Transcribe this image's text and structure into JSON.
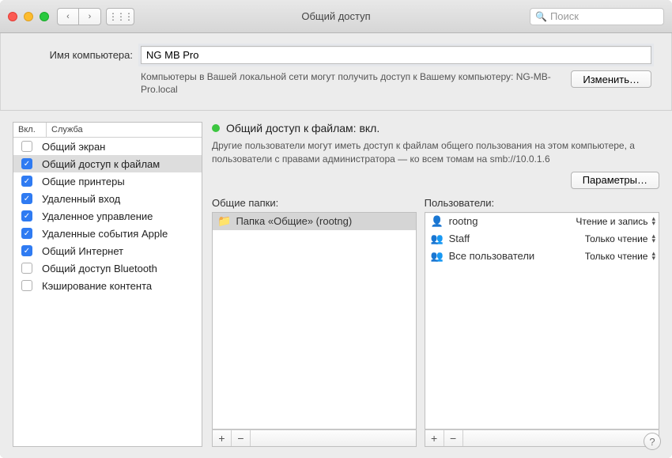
{
  "window": {
    "title": "Общий доступ"
  },
  "search": {
    "placeholder": "Поиск"
  },
  "computer": {
    "label": "Имя компьютера:",
    "value": "NG MB Pro",
    "description": "Компьютеры в Вашей локальной сети могут получить доступ к Вашему компьютеру: NG-MB-Pro.local",
    "edit_button": "Изменить…"
  },
  "services": {
    "header_on": "Вкл.",
    "header_name": "Служба",
    "items": [
      {
        "on": false,
        "label": "Общий экран",
        "selected": false
      },
      {
        "on": true,
        "label": "Общий доступ к файлам",
        "selected": true
      },
      {
        "on": true,
        "label": "Общие принтеры",
        "selected": false
      },
      {
        "on": true,
        "label": "Удаленный вход",
        "selected": false
      },
      {
        "on": true,
        "label": "Удаленное управление",
        "selected": false
      },
      {
        "on": true,
        "label": "Удаленные события Apple",
        "selected": false
      },
      {
        "on": true,
        "label": "Общий Интернет",
        "selected": false
      },
      {
        "on": false,
        "label": "Общий доступ Bluetooth",
        "selected": false
      },
      {
        "on": false,
        "label": "Кэширование контента",
        "selected": false
      }
    ]
  },
  "detail": {
    "status_text": "Общий доступ к файлам: вкл.",
    "description": "Другие пользователи могут иметь доступ к файлам общего пользования на этом компьютере, а пользователи с правами администратора — ко всем томам на smb://10.0.1.6",
    "options_button": "Параметры…",
    "shared_folders_label": "Общие папки:",
    "users_label": "Пользователи:",
    "folders": [
      {
        "label": "Папка «Общие» (rootng)",
        "selected": true
      }
    ],
    "users": [
      {
        "icon": "person",
        "name": "rootng",
        "perm": "Чтение и запись"
      },
      {
        "icon": "group",
        "name": "Staff",
        "perm": "Только чтение"
      },
      {
        "icon": "group",
        "name": "Все пользователи",
        "perm": "Только чтение"
      }
    ]
  },
  "glyphs": {
    "check": "✓",
    "plus": "+",
    "minus": "−",
    "help": "?",
    "search": "🔍",
    "grid": "⋮⋮⋮",
    "back": "‹",
    "fwd": "›",
    "folder": "📁",
    "person": "👤",
    "group": "👥",
    "up": "▴",
    "down": "▾"
  }
}
